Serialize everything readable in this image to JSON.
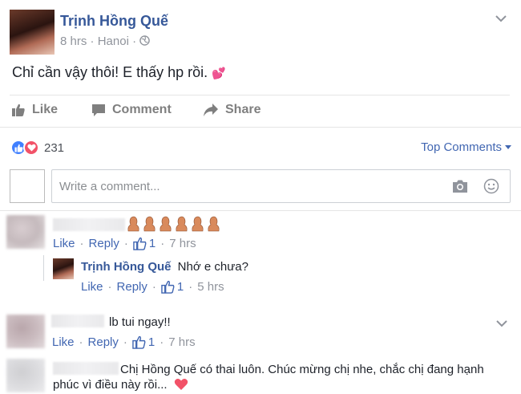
{
  "post": {
    "author": "Trịnh Hồng Quế",
    "time": "8 hrs",
    "location": "Hanoi",
    "text": "Chỉ cần vậy thôi! E thấy hp rồi.",
    "text_emoji": "💕"
  },
  "actions": {
    "like": "Like",
    "comment": "Comment",
    "share": "Share"
  },
  "reactions": {
    "count": "231"
  },
  "sort": {
    "label": "Top Comments"
  },
  "composer": {
    "placeholder": "Write a comment..."
  },
  "comments": [
    {
      "text": "",
      "like": "Like",
      "reply": "Reply",
      "likes": "1",
      "time": "7 hrs",
      "reply_item": {
        "author": "Trịnh Hồng Quế",
        "text": "Nhớ e chưa?",
        "like": "Like",
        "reply": "Reply",
        "likes": "1",
        "time": "5 hrs"
      }
    },
    {
      "text": "lb tui ngay!!",
      "like": "Like",
      "reply": "Reply",
      "likes": "1",
      "time": "7 hrs"
    },
    {
      "text_line1": "Chị Hồng Quế có thai luôn. Chúc mừng chị nhe, chắc chị đang hạnh",
      "text_line2": "phúc vì điều này rồi..."
    }
  ],
  "colors": {
    "link": "#4267b2",
    "name": "#365899",
    "meta": "#90949c",
    "like_blue": "#4080ff",
    "love_red": "#f25268"
  }
}
